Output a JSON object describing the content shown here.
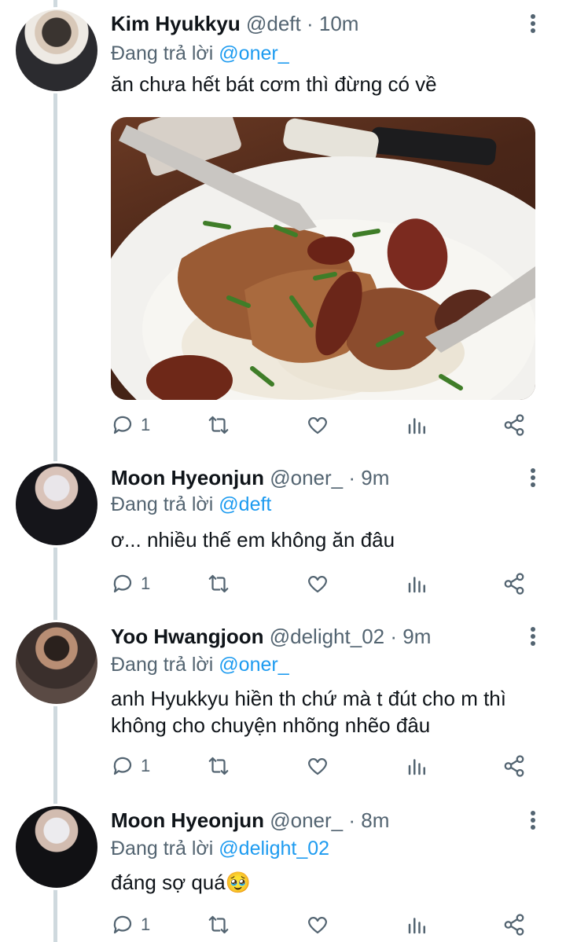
{
  "tweets": [
    {
      "name": "Kim Hyukkyu",
      "handle": "@deft",
      "time": "10m",
      "replying_prefix": "Đang trả lời",
      "replying_to": "@oner_",
      "text": "ăn chưa hết bát cơm thì đừng có về",
      "replies": "1"
    },
    {
      "name": "Moon Hyeonjun",
      "handle": "@oner_",
      "time": "9m",
      "replying_prefix": "Đang trả lời",
      "replying_to": "@deft",
      "text": "ơ... nhiều thế em không ăn đâu",
      "replies": "1"
    },
    {
      "name": "Yoo Hwangjoon",
      "handle": "@delight_02",
      "time": "9m",
      "replying_prefix": "Đang trả lời",
      "replying_to": "@oner_",
      "text": "anh Hyukkyu hiền th chứ mà t đút cho m thì không cho chuyện nhõng nhẽo đâu",
      "replies": "1"
    },
    {
      "name": "Moon Hyeonjun",
      "handle": "@oner_",
      "time": "8m",
      "replying_prefix": "Đang trả lời",
      "replying_to": "@delight_02",
      "text": "đáng sợ quá🥹",
      "replies": "1"
    }
  ],
  "separator": "·",
  "icons": [
    "more-vertical-icon",
    "reply-icon",
    "retweet-icon",
    "like-icon",
    "views-icon",
    "share-icon"
  ],
  "colors": {
    "accent": "#1d9bf0",
    "secondary_text": "#536471",
    "thread_line": "#cfd9de"
  }
}
